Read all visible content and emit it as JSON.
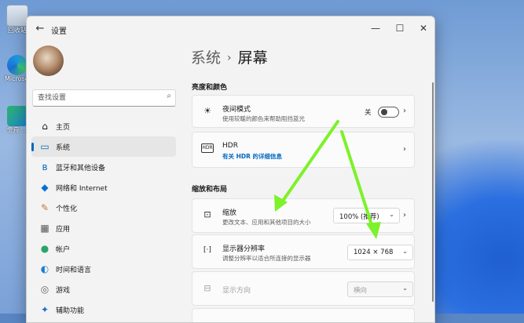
{
  "desktop": {
    "icons": [
      {
        "label": "回收站",
        "name": "recycle-bin"
      },
      {
        "label": "Microsoft Edge",
        "name": "edge"
      },
      {
        "label": "金舟 ...",
        "name": "app"
      }
    ]
  },
  "window": {
    "title": "设置",
    "controls": {
      "minimize": "—",
      "maximize": "☐",
      "close": "✕"
    },
    "back": "←"
  },
  "sidebar": {
    "search_placeholder": "查找设置",
    "items": [
      {
        "label": "主页",
        "icon": "home-icon",
        "glyph": "⌂",
        "color": "#1a1a1a",
        "active": false
      },
      {
        "label": "系统",
        "icon": "system-icon",
        "glyph": "▭",
        "color": "#0067c0",
        "active": true
      },
      {
        "label": "蓝牙和其他设备",
        "icon": "bluetooth-icon",
        "glyph": "ʙ",
        "color": "#0067c0",
        "active": false
      },
      {
        "label": "网络和 Internet",
        "icon": "network-icon",
        "glyph": "◆",
        "color": "#0a6fd0",
        "active": false
      },
      {
        "label": "个性化",
        "icon": "personalization-icon",
        "glyph": "✎",
        "color": "#c8723a",
        "active": false
      },
      {
        "label": "应用",
        "icon": "apps-icon",
        "glyph": "▦",
        "color": "#555555",
        "active": false
      },
      {
        "label": "帐户",
        "icon": "account-icon",
        "glyph": "●",
        "color": "#2aa56a",
        "active": false
      },
      {
        "label": "时间和语言",
        "icon": "time-language-icon",
        "glyph": "◐",
        "color": "#1a7fd6",
        "active": false
      },
      {
        "label": "游戏",
        "icon": "gaming-icon",
        "glyph": "◎",
        "color": "#666666",
        "active": false
      },
      {
        "label": "辅助功能",
        "icon": "accessibility-icon",
        "glyph": "✦",
        "color": "#1a6ed0",
        "active": false
      }
    ]
  },
  "main": {
    "breadcrumb_parent": "系统",
    "breadcrumb_sep": "›",
    "breadcrumb_current": "屏幕",
    "sections": [
      {
        "title": "亮度和颜色"
      },
      {
        "title": "缩放和布局"
      }
    ],
    "night_light": {
      "title": "夜间模式",
      "subtitle": "使用较暖的颜色来帮助阻挡蓝光",
      "state_label": "关",
      "icon_glyph": "☀"
    },
    "hdr": {
      "title": "HDR",
      "link": "有关 HDR 的详细信息",
      "icon_glyph": "HDR"
    },
    "scale": {
      "title": "缩放",
      "subtitle": "更改文本、应用和其他项目的大小",
      "value": "100% (推荐)",
      "icon_glyph": "⊡"
    },
    "resolution": {
      "title": "显示器分辨率",
      "subtitle": "调整分辨率以适合所连接的显示器",
      "value": "1024 × 768",
      "icon_glyph": "[·]"
    },
    "orientation": {
      "title": "显示方向",
      "value": "横向",
      "icon_glyph": "⊟"
    }
  },
  "annotations": {
    "arrow_color": "#7cf22a"
  }
}
